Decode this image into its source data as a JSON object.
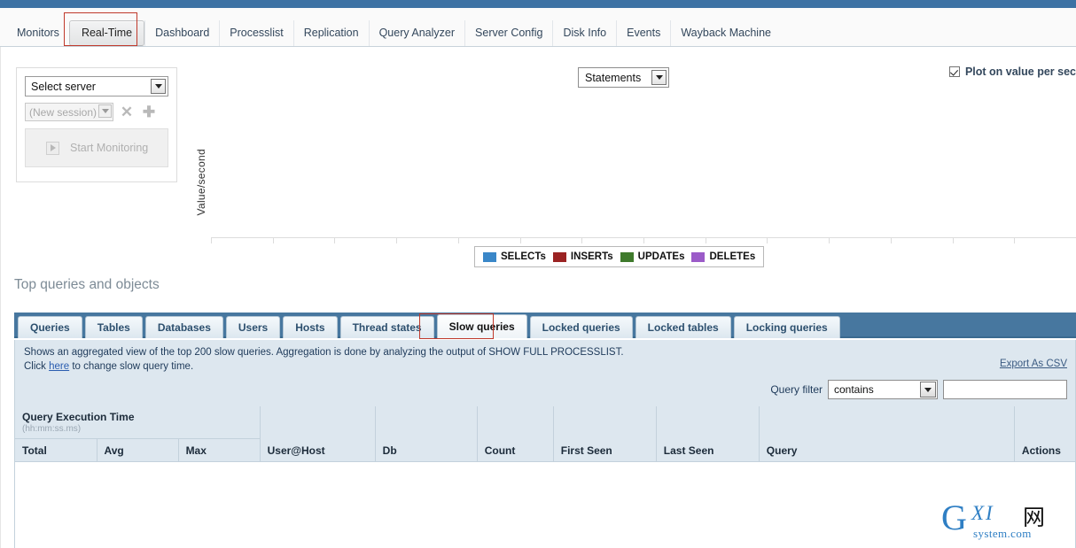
{
  "nav": {
    "tabs": [
      {
        "label": "Monitors",
        "active": false
      },
      {
        "label": "Real-Time",
        "active": true
      },
      {
        "label": "Dashboard",
        "active": false
      },
      {
        "label": "Processlist",
        "active": false
      },
      {
        "label": "Replication",
        "active": false
      },
      {
        "label": "Query Analyzer",
        "active": false
      },
      {
        "label": "Server Config",
        "active": false
      },
      {
        "label": "Disk Info",
        "active": false
      },
      {
        "label": "Events",
        "active": false
      },
      {
        "label": "Wayback Machine",
        "active": false
      }
    ]
  },
  "server_panel": {
    "server_select_value": "Select server",
    "session_select_value": "(New session)",
    "delete_session_icon": "close-icon",
    "add_session_icon": "plus-icon",
    "start_monitoring_label": "Start Monitoring",
    "play_icon": "play-icon"
  },
  "chart_toolbar": {
    "statements_select_value": "Statements",
    "plot_per_sec_label": "Plot on value per sec",
    "plot_per_sec_checked": true
  },
  "chart_data": {
    "type": "line",
    "title": "",
    "xlabel": "",
    "ylabel": "Value/second",
    "series": [
      {
        "name": "SELECTs",
        "color": "#3a87c8",
        "values": []
      },
      {
        "name": "INSERTs",
        "color": "#9b2323",
        "values": []
      },
      {
        "name": "UPDATEs",
        "color": "#3f7a2c",
        "values": []
      },
      {
        "name": "DELETEs",
        "color": "#9b5bc8",
        "values": []
      }
    ],
    "x": [],
    "legend_position": "bottom-center",
    "grid": false,
    "empty": true
  },
  "section": {
    "title": "Top queries and objects"
  },
  "subtabs": [
    {
      "label": "Queries",
      "active": false
    },
    {
      "label": "Tables",
      "active": false
    },
    {
      "label": "Databases",
      "active": false
    },
    {
      "label": "Users",
      "active": false
    },
    {
      "label": "Hosts",
      "active": false
    },
    {
      "label": "Thread states",
      "active": false
    },
    {
      "label": "Slow queries",
      "active": true
    },
    {
      "label": "Locked queries",
      "active": false
    },
    {
      "label": "Locked tables",
      "active": false
    },
    {
      "label": "Locking queries",
      "active": false
    }
  ],
  "info": {
    "line1_before": "Shows an aggregated view of the top 200 slow queries. Aggregation is done by analyzing the output of SHOW FULL PROCESSLIST.",
    "line2_before": "Click ",
    "link_label": "here",
    "line2_after": " to change slow query time.",
    "export_label": "Export As CSV"
  },
  "filter": {
    "label": "Query filter",
    "operator_value": "contains",
    "text_value": "",
    "text_placeholder": ""
  },
  "table": {
    "group_header": "Query Execution Time",
    "group_header_sub": "(hh:mm:ss.ms)",
    "columns": [
      "Total",
      "Avg",
      "Max",
      "User@Host",
      "Db",
      "Count",
      "First Seen",
      "Last Seen",
      "Query",
      "Actions"
    ],
    "rows": []
  },
  "watermark": {
    "g": "G",
    "xi": "XI",
    "cn": "网",
    "system": "system.com"
  }
}
